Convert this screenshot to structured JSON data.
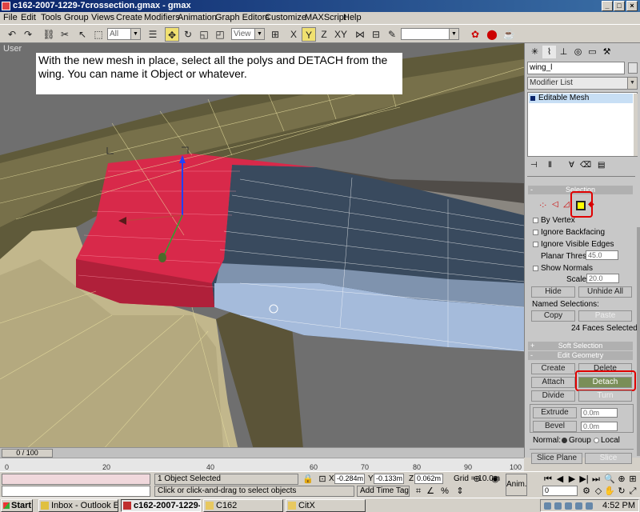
{
  "window": {
    "title": "c162-2007-1229-7crossection.gmax - gmax"
  },
  "menu": [
    "File",
    "Edit",
    "Tools",
    "Group",
    "Views",
    "Create",
    "Modifiers",
    "Animation",
    "Graph Editors",
    "Customize",
    "MAXScript",
    "Help"
  ],
  "toolbar": {
    "selection_filter": "All",
    "reference_coord": "View",
    "named_selection": ""
  },
  "viewport": {
    "label": "User",
    "note": "With the new mesh in place, select all the polys and DETACH from the wing.  You can name it Object or whatever."
  },
  "command_panel": {
    "object_name": "wing_l",
    "modifier_list": "Modifier List",
    "stack_item": "Editable Mesh",
    "selection": {
      "header": "Selection",
      "by_vertex": "By Vertex",
      "ignore_backfacing": "Ignore Backfacing",
      "ignore_visible_edges": "Ignore Visible Edges",
      "planar_thresh_label": "Planar Thresh:",
      "planar_thresh_value": "45.0",
      "show_normals": "Show Normals",
      "scale_label": "Scale:",
      "scale_value": "20.0",
      "hide": "Hide",
      "unhide_all": "Unhide All",
      "named_selections": "Named Selections:",
      "copy": "Copy",
      "paste": "Paste",
      "status": "24 Faces Selected"
    },
    "soft_selection": {
      "header": "Soft Selection"
    },
    "edit_geometry": {
      "header": "Edit Geometry",
      "create": "Create",
      "delete": "Delete",
      "attach": "Attach",
      "detach": "Detach",
      "divide": "Divide",
      "turn": "Turn",
      "extrude": "Extrude",
      "extrude_value": "0.0m",
      "bevel": "Bevel",
      "bevel_value": "0.0m",
      "normal_label": "Normal:",
      "group": "Group",
      "local": "Local",
      "slice_plane": "Slice Plane",
      "slice": "Slice"
    }
  },
  "timeline": {
    "frame_display": "0 / 100",
    "ticks": [
      "0",
      "20",
      "40",
      "60",
      "70",
      "80",
      "90",
      "100"
    ]
  },
  "status": {
    "selected": "1 Object Selected",
    "prompt": "Click or click-and-drag to select objects",
    "x_label": "X",
    "x": "-0.284m",
    "y_label": "Y",
    "y": "-0.133m",
    "z_label": "Z",
    "z": "0.062m",
    "grid": "Grid = 10.0m",
    "add_time_tag": "Add Time Tag",
    "anim": "Anim.",
    "frame": "0"
  },
  "taskbar": {
    "start": "Start",
    "tasks": [
      "Inbox - Outlook E...",
      "c162-2007-1229-...",
      "C162",
      "CitX"
    ],
    "clock": "4:52 PM"
  }
}
